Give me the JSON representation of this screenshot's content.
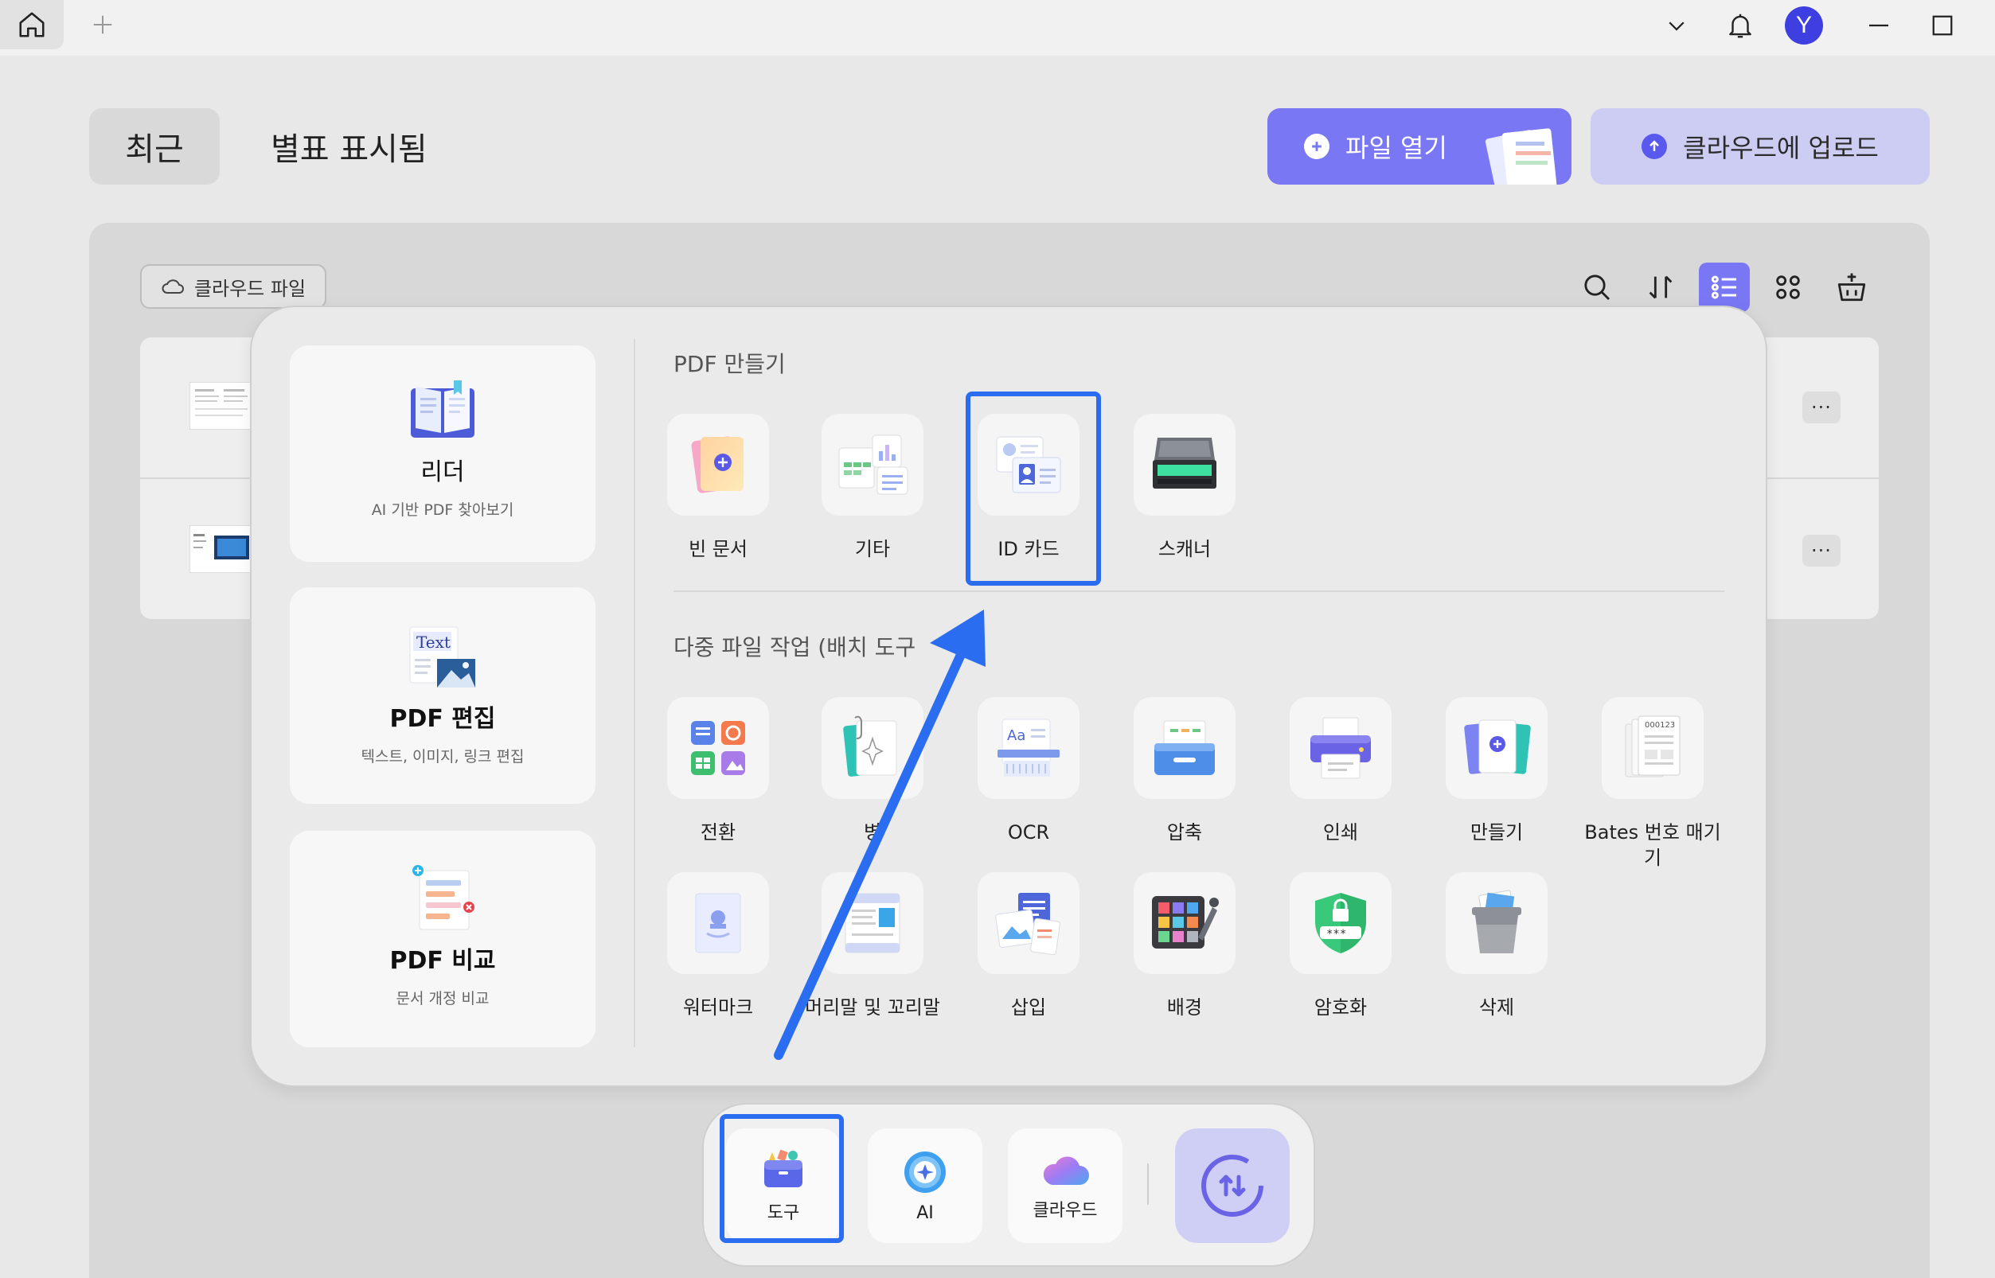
{
  "titlebar": {
    "avatar_initial": "Y"
  },
  "header": {
    "tab_recent": "최근",
    "tab_starred": "별표 표시됨",
    "open_file": "파일 열기",
    "upload_cloud": "클라우드에 업로드"
  },
  "filebar": {
    "cloud_files": "클라우드 파일"
  },
  "files": {
    "more": "···"
  },
  "tools": {
    "cards": [
      {
        "title": "리더",
        "subtitle": "AI 기반 PDF 찾아보기"
      },
      {
        "title": "PDF 편집",
        "subtitle": "텍스트, 이미지, 링크 편집",
        "icon_text": "Text"
      },
      {
        "title": "PDF 비교",
        "subtitle": "문서 개정 비교"
      }
    ],
    "create_title": "PDF 만들기",
    "create": [
      "빈 문서",
      "기타",
      "ID 카드",
      "스캐너"
    ],
    "batch_title": "다중 파일 작업 (배치 도구",
    "batch_row1": [
      "전환",
      "병",
      "OCR",
      "압축",
      "인쇄",
      "만들기",
      "Bates 번호 매기기"
    ],
    "batch_row2": [
      "워터마크",
      "머리말 및 꼬리말",
      "삽입",
      "배경",
      "암호화",
      "삭제"
    ],
    "ocr_icon_text": "Aa",
    "bates_icon_text": "000123",
    "encrypt_icon_text": "***"
  },
  "dock": {
    "tools": "도구",
    "ai": "AI",
    "cloud": "클라우드"
  },
  "colors": {
    "accent": "#7a77f4",
    "highlight": "#2b6df0",
    "avatar": "#3e3fe0"
  }
}
